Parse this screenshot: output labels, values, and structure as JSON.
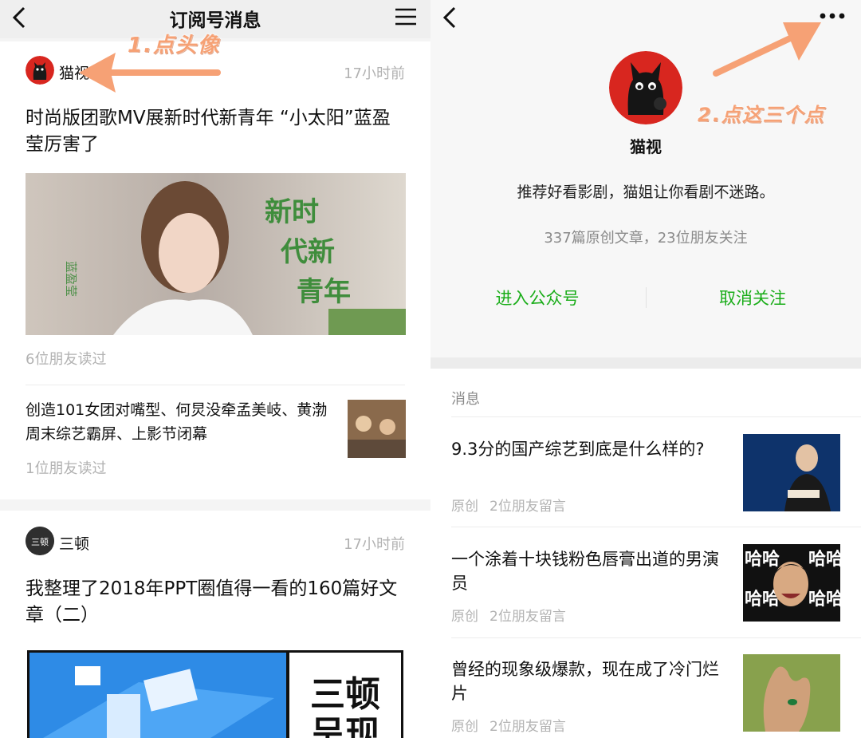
{
  "left": {
    "header": {
      "title": "订阅号消息"
    },
    "card1": {
      "account_name": "猫视",
      "time": "17小时前",
      "headline": "时尚版团歌MV展新时代新青年 “小太阳”蓝盈莹厉害了",
      "cover_overlay": "新时代新青年",
      "cover_side_text": "蓝盈莹",
      "readers": "6位朋友读过",
      "sub_article": {
        "title": "创造101女团对嘴型、何炅没牵孟美岐、黄渤周末综艺霸屏、上影节闭幕",
        "readers": "1位朋友读过"
      }
    },
    "card2": {
      "account_name": "三顿",
      "avatar_text": "三顿",
      "time": "17小时前",
      "headline": "我整理了2018年PPT圈值得一看的160篇好文章（二）",
      "cover_brand": "三顿",
      "cover_brand_line2": "呈现"
    }
  },
  "right": {
    "profile": {
      "name": "猫视",
      "description": "推荐好看影剧，猫姐让你看剧不迷路。",
      "stats": "337篇原创文章，23位朋友关注",
      "enter_label": "进入公众号",
      "unfollow_label": "取消关注"
    },
    "messages": {
      "section_label": "消息",
      "items": [
        {
          "title": "9.3分的国产综艺到底是什么样的?",
          "tag": "原创",
          "comments": "2位朋友留言"
        },
        {
          "title": "一个涂着十块钱粉色唇膏出道的男演员",
          "tag": "原创",
          "comments": "2位朋友留言",
          "thumb_text": "哈哈"
        },
        {
          "title": "曾经的现象级爆款，现在成了冷门烂片",
          "tag": "原创",
          "comments": "2位朋友留言"
        }
      ]
    }
  },
  "annotations": {
    "step1": "1.点头像",
    "step2": "2.点这三个点"
  },
  "colors": {
    "accent_green": "#1aad19",
    "annotation_orange": "#f6a175",
    "avatar_red": "#d8261f"
  }
}
